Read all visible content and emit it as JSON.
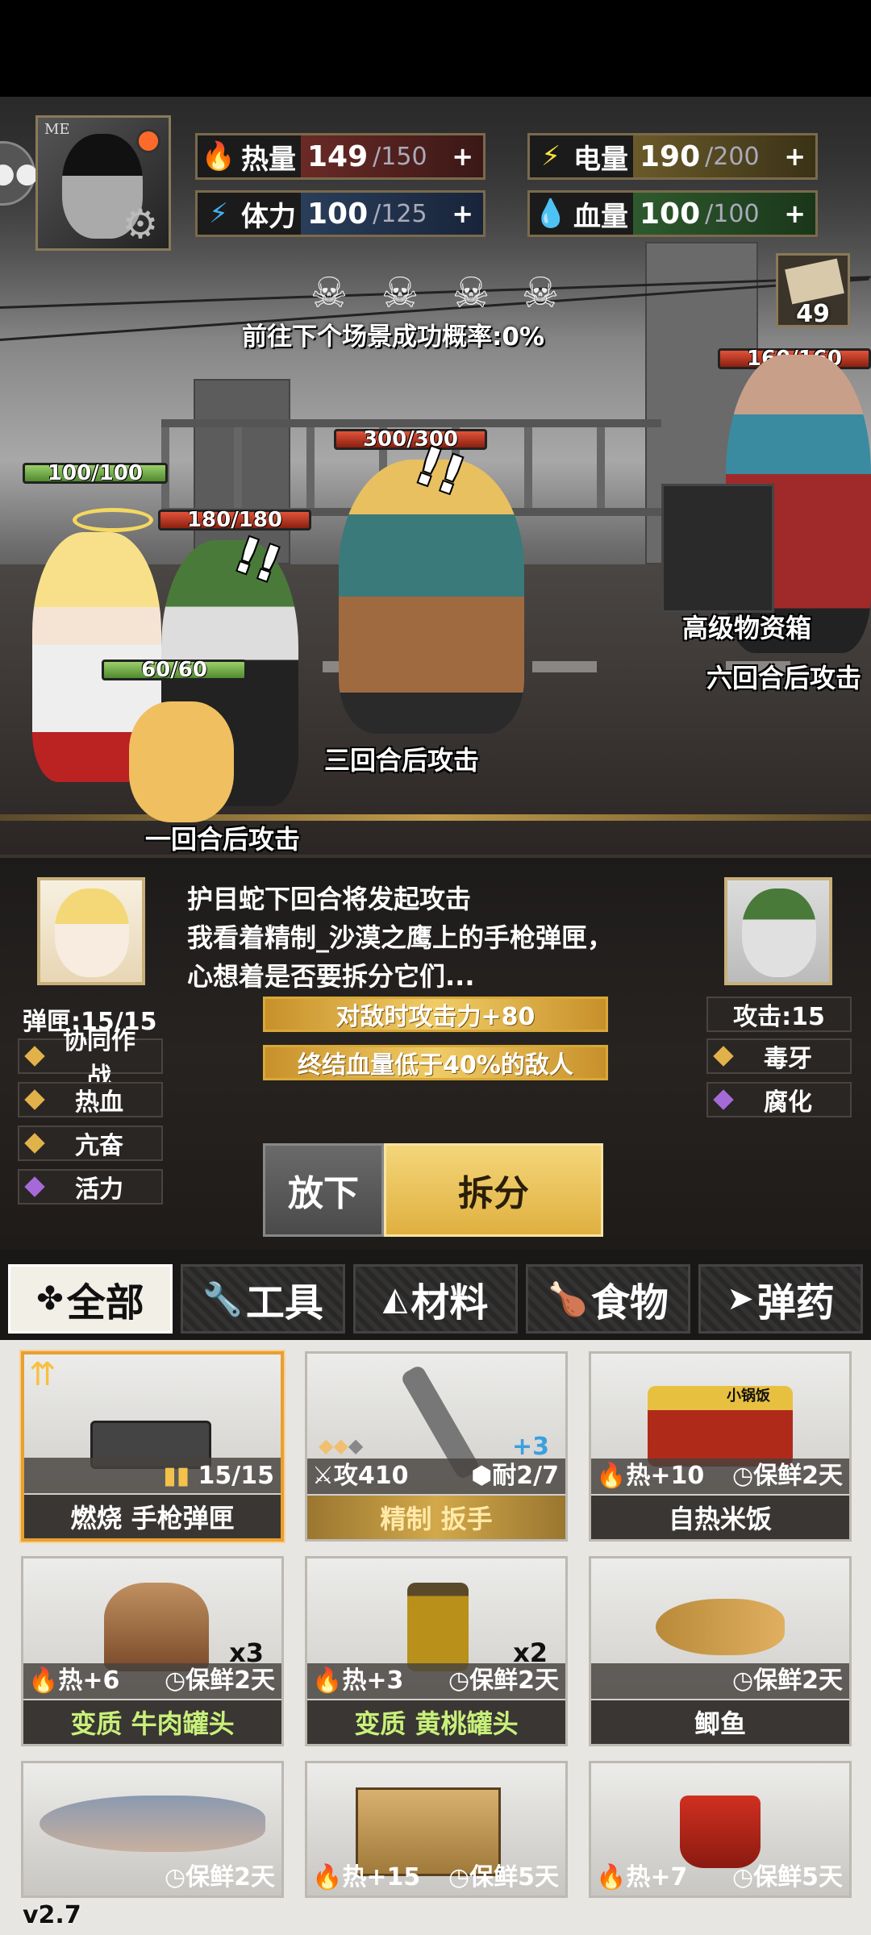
{
  "player": {
    "badge": "ME"
  },
  "stats": {
    "calorie": {
      "label": "热量",
      "current": "149",
      "max": "/150",
      "plus": "+"
    },
    "power": {
      "label": "电量",
      "current": "190",
      "max": "/200",
      "plus": "+"
    },
    "stamina": {
      "label": "体力",
      "current": "100",
      "max": "/125",
      "plus": "+"
    },
    "blood": {
      "label": "血量",
      "current": "100",
      "max": "/100",
      "plus": "+"
    }
  },
  "scene": {
    "probability": "前往下个场景成功概率:0%",
    "inventory_count": "49",
    "hp_bars": {
      "angel": "100/100",
      "soldier": "180/180",
      "scarecrow": "300/300",
      "corgi": "60/60",
      "nurse": "160/160"
    },
    "texts": {
      "supply_box": "高级物资箱",
      "six_turns": "六回合后攻击",
      "three_turns": "三回合后攻击",
      "one_turn": "一回合后攻击"
    }
  },
  "info": {
    "line1": "护目蛇下回合将发起攻击",
    "line2": "我看着精制_沙漠之鹰上的手枪弹匣，",
    "line3": "心想着是否要拆分它们...",
    "magazine": "弹匣:15/15",
    "perk1": "对敌时攻击力+80",
    "perk2": "终结血量低于40%的敌人",
    "left_traits": [
      "协同作战",
      "热血",
      "亢奋",
      "活力"
    ],
    "enemy_attack": "攻击:15",
    "enemy_traits": [
      "毒牙",
      "腐化"
    ],
    "drop_label": "放下",
    "split_label": "拆分"
  },
  "tabs": [
    "全部",
    "工具",
    "材料",
    "食物",
    "弹药"
  ],
  "items": [
    {
      "name": "燃烧 手枪弹匣",
      "stat_right": "15/15"
    },
    {
      "name": "精制 扳手",
      "stat_left": "攻410",
      "stat_right": "耐2/7",
      "upgrade": "+3"
    },
    {
      "name": "自热米饭",
      "stat_left": "热+10",
      "stat_right": "保鲜2天",
      "label": "小锅饭"
    },
    {
      "name": "变质 牛肉罐头",
      "stat_left": "热+6",
      "stat_right": "保鲜2天",
      "qty": "x3"
    },
    {
      "name": "变质 黄桃罐头",
      "stat_left": "热+3",
      "stat_right": "保鲜2天",
      "qty": "x2"
    },
    {
      "name": "鲫鱼",
      "stat_right": "保鲜2天"
    },
    {
      "stat_right": "保鲜2天"
    },
    {
      "stat_left": "热+15",
      "stat_right": "保鲜5天"
    },
    {
      "stat_left": "热+7",
      "stat_right": "保鲜5天"
    }
  ],
  "version": "v2.7",
  "colors": {
    "accent_gold": "#e0b040",
    "selected_border": "#e8a030",
    "green_text": "#c8f07a"
  }
}
